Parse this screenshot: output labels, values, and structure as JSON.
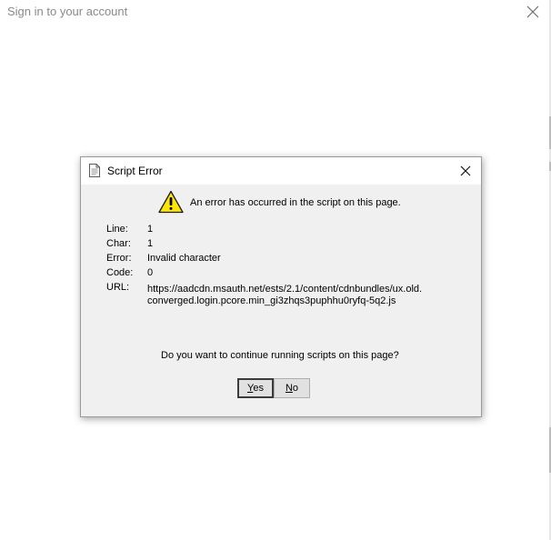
{
  "window": {
    "title": "Sign in to your account",
    "close_icon": "close-icon"
  },
  "dialog": {
    "title": "Script Error",
    "title_icon": "document-icon",
    "close_icon": "close-icon",
    "warning_icon": "warning-icon",
    "headline": "An error has occurred in the script on this page.",
    "details": [
      {
        "label": "Line:",
        "value": "1"
      },
      {
        "label": "Char:",
        "value": "1"
      },
      {
        "label": "Error:",
        "value": "Invalid character"
      },
      {
        "label": "Code:",
        "value": "0"
      },
      {
        "label": "URL:",
        "value_line1": "https://aadcdn.msauth.net/ests/2.1/content/cdnbundles/ux.old.",
        "value_line2": "converged.login.pcore.min_gi3zhqs3puphhu0ryfq-5q2.js"
      }
    ],
    "question": "Do you want to continue running scripts on this page?",
    "yes_button": "Yes",
    "no_button": "No"
  },
  "colors": {
    "warning_fill": "#ffe600",
    "dialog_background": "#f0f0f0",
    "button_background": "#e1e1e1"
  }
}
